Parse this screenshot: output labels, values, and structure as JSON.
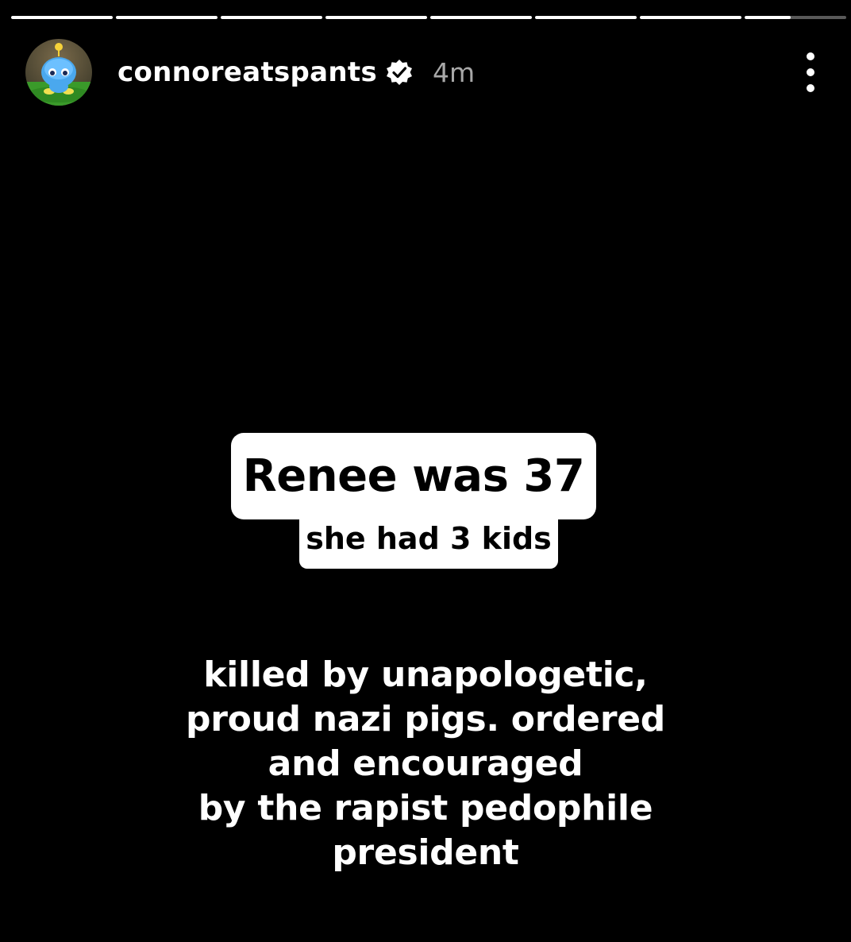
{
  "progress": {
    "segments": [
      1,
      1,
      1,
      1,
      1,
      1,
      1,
      0.45
    ]
  },
  "header": {
    "username": "connoreatspants",
    "verified_icon": "verified-badge-icon",
    "timestamp": "4m",
    "avatar_icon": "chao-avatar",
    "more_icon": "more-vertical-icon"
  },
  "story": {
    "headline": "Renee was 37",
    "subline": "she had 3 kids",
    "body_lines": [
      "killed by unapologetic,",
      "proud nazi pigs. ordered",
      "and encouraged",
      "by the rapist pedophile",
      "president"
    ]
  },
  "colors": {
    "background": "#000000",
    "text": "#ffffff",
    "muted": "#a8a8a8",
    "caption_bg": "#ffffff",
    "caption_text": "#000000"
  }
}
